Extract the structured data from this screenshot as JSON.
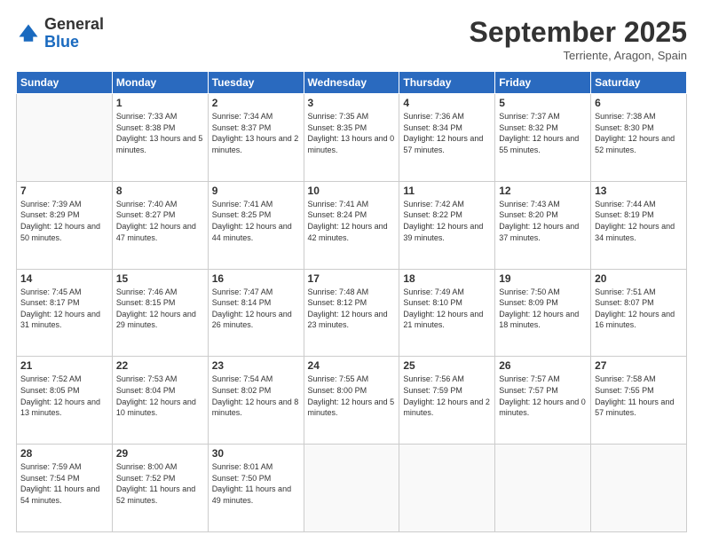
{
  "logo": {
    "general": "General",
    "blue": "Blue"
  },
  "title": "September 2025",
  "subtitle": "Terriente, Aragon, Spain",
  "weekdays": [
    "Sunday",
    "Monday",
    "Tuesday",
    "Wednesday",
    "Thursday",
    "Friday",
    "Saturday"
  ],
  "weeks": [
    [
      {
        "day": "",
        "sunrise": "",
        "sunset": "",
        "daylight": ""
      },
      {
        "day": "1",
        "sunrise": "Sunrise: 7:33 AM",
        "sunset": "Sunset: 8:38 PM",
        "daylight": "Daylight: 13 hours and 5 minutes."
      },
      {
        "day": "2",
        "sunrise": "Sunrise: 7:34 AM",
        "sunset": "Sunset: 8:37 PM",
        "daylight": "Daylight: 13 hours and 2 minutes."
      },
      {
        "day": "3",
        "sunrise": "Sunrise: 7:35 AM",
        "sunset": "Sunset: 8:35 PM",
        "daylight": "Daylight: 13 hours and 0 minutes."
      },
      {
        "day": "4",
        "sunrise": "Sunrise: 7:36 AM",
        "sunset": "Sunset: 8:34 PM",
        "daylight": "Daylight: 12 hours and 57 minutes."
      },
      {
        "day": "5",
        "sunrise": "Sunrise: 7:37 AM",
        "sunset": "Sunset: 8:32 PM",
        "daylight": "Daylight: 12 hours and 55 minutes."
      },
      {
        "day": "6",
        "sunrise": "Sunrise: 7:38 AM",
        "sunset": "Sunset: 8:30 PM",
        "daylight": "Daylight: 12 hours and 52 minutes."
      }
    ],
    [
      {
        "day": "7",
        "sunrise": "Sunrise: 7:39 AM",
        "sunset": "Sunset: 8:29 PM",
        "daylight": "Daylight: 12 hours and 50 minutes."
      },
      {
        "day": "8",
        "sunrise": "Sunrise: 7:40 AM",
        "sunset": "Sunset: 8:27 PM",
        "daylight": "Daylight: 12 hours and 47 minutes."
      },
      {
        "day": "9",
        "sunrise": "Sunrise: 7:41 AM",
        "sunset": "Sunset: 8:25 PM",
        "daylight": "Daylight: 12 hours and 44 minutes."
      },
      {
        "day": "10",
        "sunrise": "Sunrise: 7:41 AM",
        "sunset": "Sunset: 8:24 PM",
        "daylight": "Daylight: 12 hours and 42 minutes."
      },
      {
        "day": "11",
        "sunrise": "Sunrise: 7:42 AM",
        "sunset": "Sunset: 8:22 PM",
        "daylight": "Daylight: 12 hours and 39 minutes."
      },
      {
        "day": "12",
        "sunrise": "Sunrise: 7:43 AM",
        "sunset": "Sunset: 8:20 PM",
        "daylight": "Daylight: 12 hours and 37 minutes."
      },
      {
        "day": "13",
        "sunrise": "Sunrise: 7:44 AM",
        "sunset": "Sunset: 8:19 PM",
        "daylight": "Daylight: 12 hours and 34 minutes."
      }
    ],
    [
      {
        "day": "14",
        "sunrise": "Sunrise: 7:45 AM",
        "sunset": "Sunset: 8:17 PM",
        "daylight": "Daylight: 12 hours and 31 minutes."
      },
      {
        "day": "15",
        "sunrise": "Sunrise: 7:46 AM",
        "sunset": "Sunset: 8:15 PM",
        "daylight": "Daylight: 12 hours and 29 minutes."
      },
      {
        "day": "16",
        "sunrise": "Sunrise: 7:47 AM",
        "sunset": "Sunset: 8:14 PM",
        "daylight": "Daylight: 12 hours and 26 minutes."
      },
      {
        "day": "17",
        "sunrise": "Sunrise: 7:48 AM",
        "sunset": "Sunset: 8:12 PM",
        "daylight": "Daylight: 12 hours and 23 minutes."
      },
      {
        "day": "18",
        "sunrise": "Sunrise: 7:49 AM",
        "sunset": "Sunset: 8:10 PM",
        "daylight": "Daylight: 12 hours and 21 minutes."
      },
      {
        "day": "19",
        "sunrise": "Sunrise: 7:50 AM",
        "sunset": "Sunset: 8:09 PM",
        "daylight": "Daylight: 12 hours and 18 minutes."
      },
      {
        "day": "20",
        "sunrise": "Sunrise: 7:51 AM",
        "sunset": "Sunset: 8:07 PM",
        "daylight": "Daylight: 12 hours and 16 minutes."
      }
    ],
    [
      {
        "day": "21",
        "sunrise": "Sunrise: 7:52 AM",
        "sunset": "Sunset: 8:05 PM",
        "daylight": "Daylight: 12 hours and 13 minutes."
      },
      {
        "day": "22",
        "sunrise": "Sunrise: 7:53 AM",
        "sunset": "Sunset: 8:04 PM",
        "daylight": "Daylight: 12 hours and 10 minutes."
      },
      {
        "day": "23",
        "sunrise": "Sunrise: 7:54 AM",
        "sunset": "Sunset: 8:02 PM",
        "daylight": "Daylight: 12 hours and 8 minutes."
      },
      {
        "day": "24",
        "sunrise": "Sunrise: 7:55 AM",
        "sunset": "Sunset: 8:00 PM",
        "daylight": "Daylight: 12 hours and 5 minutes."
      },
      {
        "day": "25",
        "sunrise": "Sunrise: 7:56 AM",
        "sunset": "Sunset: 7:59 PM",
        "daylight": "Daylight: 12 hours and 2 minutes."
      },
      {
        "day": "26",
        "sunrise": "Sunrise: 7:57 AM",
        "sunset": "Sunset: 7:57 PM",
        "daylight": "Daylight: 12 hours and 0 minutes."
      },
      {
        "day": "27",
        "sunrise": "Sunrise: 7:58 AM",
        "sunset": "Sunset: 7:55 PM",
        "daylight": "Daylight: 11 hours and 57 minutes."
      }
    ],
    [
      {
        "day": "28",
        "sunrise": "Sunrise: 7:59 AM",
        "sunset": "Sunset: 7:54 PM",
        "daylight": "Daylight: 11 hours and 54 minutes."
      },
      {
        "day": "29",
        "sunrise": "Sunrise: 8:00 AM",
        "sunset": "Sunset: 7:52 PM",
        "daylight": "Daylight: 11 hours and 52 minutes."
      },
      {
        "day": "30",
        "sunrise": "Sunrise: 8:01 AM",
        "sunset": "Sunset: 7:50 PM",
        "daylight": "Daylight: 11 hours and 49 minutes."
      },
      {
        "day": "",
        "sunrise": "",
        "sunset": "",
        "daylight": ""
      },
      {
        "day": "",
        "sunrise": "",
        "sunset": "",
        "daylight": ""
      },
      {
        "day": "",
        "sunrise": "",
        "sunset": "",
        "daylight": ""
      },
      {
        "day": "",
        "sunrise": "",
        "sunset": "",
        "daylight": ""
      }
    ]
  ]
}
